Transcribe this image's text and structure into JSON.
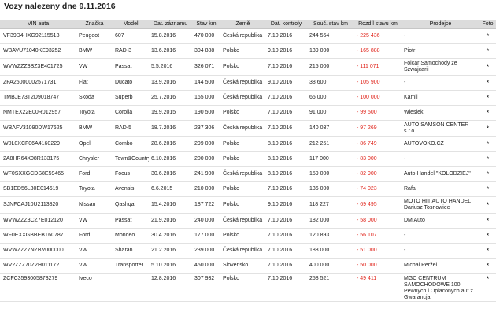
{
  "page": {
    "title": "Vozy nalezeny dne 9.11.2016"
  },
  "columns": [
    "VIN auta",
    "Značka",
    "Model",
    "Dat. záznamu",
    "Stav km",
    "Země",
    "Dat. kontroly",
    "Souč. stav km",
    "Rozdíl stavu km",
    "Prodejce",
    "Foto"
  ],
  "photo_icon": "camera-icon",
  "colors": {
    "negative": "#e0241b",
    "header_bg": "#dcdcdc"
  },
  "rows": [
    {
      "vin": "VF39D4HXG92115518",
      "brand": "Peugeot",
      "model": "607",
      "rec_date": "15.8.2016",
      "km": "470 000",
      "country": "Česká republika",
      "check_date": "7.10.2016",
      "cur_km": "244 564",
      "diff": "- 225 436",
      "seller": "-",
      "photo": "*"
    },
    {
      "vin": "WBAVU71040KE93252",
      "brand": "BMW",
      "model": "RAD-3",
      "rec_date": "13.6.2016",
      "km": "304 888",
      "country": "Polsko",
      "check_date": "9.10.2016",
      "cur_km": "139 000",
      "diff": "- 165 888",
      "seller": "Piotr",
      "photo": "*"
    },
    {
      "vin": "WVWZZZ3BZ3E401725",
      "brand": "VW",
      "model": "Passat",
      "rec_date": "5.5.2016",
      "km": "326 071",
      "country": "Polsko",
      "check_date": "7.10.2016",
      "cur_km": "215 000",
      "diff": "- 111 071",
      "seller": "Folcar Samochody ze Szwajcarii",
      "photo": "*"
    },
    {
      "vin": "ZFA25000002571731",
      "brand": "Fiat",
      "model": "Ducato",
      "rec_date": "13.9.2016",
      "km": "144 500",
      "country": "Česká republika",
      "check_date": "9.10.2016",
      "cur_km": "38 600",
      "diff": "- 105 900",
      "seller": "-",
      "photo": "*"
    },
    {
      "vin": "TMBJE73T2D9018747",
      "brand": "Skoda",
      "model": "Superb",
      "rec_date": "25.7.2016",
      "km": "165 000",
      "country": "Česká republika",
      "check_date": "7.10.2016",
      "cur_km": "65 000",
      "diff": "- 100 000",
      "seller": "Kamil",
      "photo": "*"
    },
    {
      "vin": "NMTEX22E00R012957",
      "brand": "Toyota",
      "model": "Corolla",
      "rec_date": "19.9.2015",
      "km": "190 500",
      "country": "Polsko",
      "check_date": "7.10.2016",
      "cur_km": "91 000",
      "diff": "- 99 500",
      "seller": "Wiesiek",
      "photo": "*"
    },
    {
      "vin": "WBAFV31090DW17625",
      "brand": "BMW",
      "model": "RAD-5",
      "rec_date": "18.7.2016",
      "km": "237 306",
      "country": "Česká republika",
      "check_date": "7.10.2016",
      "cur_km": "140 037",
      "diff": "- 97 269",
      "seller": "AUTO SAMSON CENTER s.r.o",
      "photo": "*"
    },
    {
      "vin": "W0L0XCF06A4160229",
      "brand": "Opel",
      "model": "Combo",
      "rec_date": "28.6.2016",
      "km": "299 000",
      "country": "Polsko",
      "check_date": "8.10.2016",
      "cur_km": "212 251",
      "diff": "- 86 749",
      "seller": "AUTOVOKO.CZ",
      "photo": "*"
    },
    {
      "vin": "2A8HR64X08R133175",
      "brand": "Chrysler",
      "model": "Town&Country",
      "rec_date": "6.10.2016",
      "km": "200 000",
      "country": "Polsko",
      "check_date": "8.10.2016",
      "cur_km": "117 000",
      "diff": "- 83 000",
      "seller": "-",
      "photo": "*"
    },
    {
      "vin": "WF0SXXGCDS8E59465",
      "brand": "Ford",
      "model": "Focus",
      "rec_date": "30.6.2016",
      "km": "241 900",
      "country": "Česká republika",
      "check_date": "8.10.2016",
      "cur_km": "159 000",
      "diff": "- 82 900",
      "seller": "Auto-Handel \"KOLODZIEJ\"",
      "photo": "*"
    },
    {
      "vin": "SB1ED56L30E014619",
      "brand": "Toyota",
      "model": "Avensis",
      "rec_date": "6.6.2015",
      "km": "210 000",
      "country": "Polsko",
      "check_date": "7.10.2016",
      "cur_km": "136 000",
      "diff": "- 74 023",
      "seller": "Rafal",
      "photo": "*"
    },
    {
      "vin": "SJNFCAJ10U2113820",
      "brand": "Nissan",
      "model": "Qashqai",
      "rec_date": "15.4.2016",
      "km": "187 722",
      "country": "Polsko",
      "check_date": "9.10.2016",
      "cur_km": "118 227",
      "diff": "- 69 495",
      "seller": "MOTO HIT AUTO HANDEL Dariusz Tosnowiec",
      "photo": "*"
    },
    {
      "vin": "WVWZZZ3CZ7E012120",
      "brand": "VW",
      "model": "Passat",
      "rec_date": "21.9.2016",
      "km": "240 000",
      "country": "Česká republika",
      "check_date": "7.10.2016",
      "cur_km": "182 000",
      "diff": "- 58 000",
      "seller": "DM Auto",
      "photo": "*"
    },
    {
      "vin": "WF0EXXGBBEBT60787",
      "brand": "Ford",
      "model": "Mondeo",
      "rec_date": "30.4.2016",
      "km": "177 000",
      "country": "Polsko",
      "check_date": "7.10.2016",
      "cur_km": "120 893",
      "diff": "- 56 107",
      "seller": "-",
      "photo": "*"
    },
    {
      "vin": "WVWZZZ7NZBV000000",
      "brand": "VW",
      "model": "Sharan",
      "rec_date": "21.2.2016",
      "km": "239 000",
      "country": "Česká republika",
      "check_date": "7.10.2016",
      "cur_km": "188 000",
      "diff": "- 51 000",
      "seller": "-",
      "photo": "*"
    },
    {
      "vin": "WV2ZZZ70Z2H011172",
      "brand": "VW",
      "model": "Transporter",
      "rec_date": "5.10.2016",
      "km": "450 000",
      "country": "Slovensko",
      "check_date": "7.10.2016",
      "cur_km": "400 000",
      "diff": "- 50 000",
      "seller": "Michal Peržel",
      "photo": "*"
    },
    {
      "vin": "ZCFC3593005873279",
      "brand": "Iveco",
      "model": "",
      "rec_date": "12.8.2016",
      "km": "307 932",
      "country": "Polsko",
      "check_date": "7.10.2016",
      "cur_km": "258 521",
      "diff": "- 49 411",
      "seller": "MGC CENTRUM SAMOCHODOWE 100 Pewnych i Oplaconych aut z Gwarancja",
      "photo": "*"
    }
  ]
}
